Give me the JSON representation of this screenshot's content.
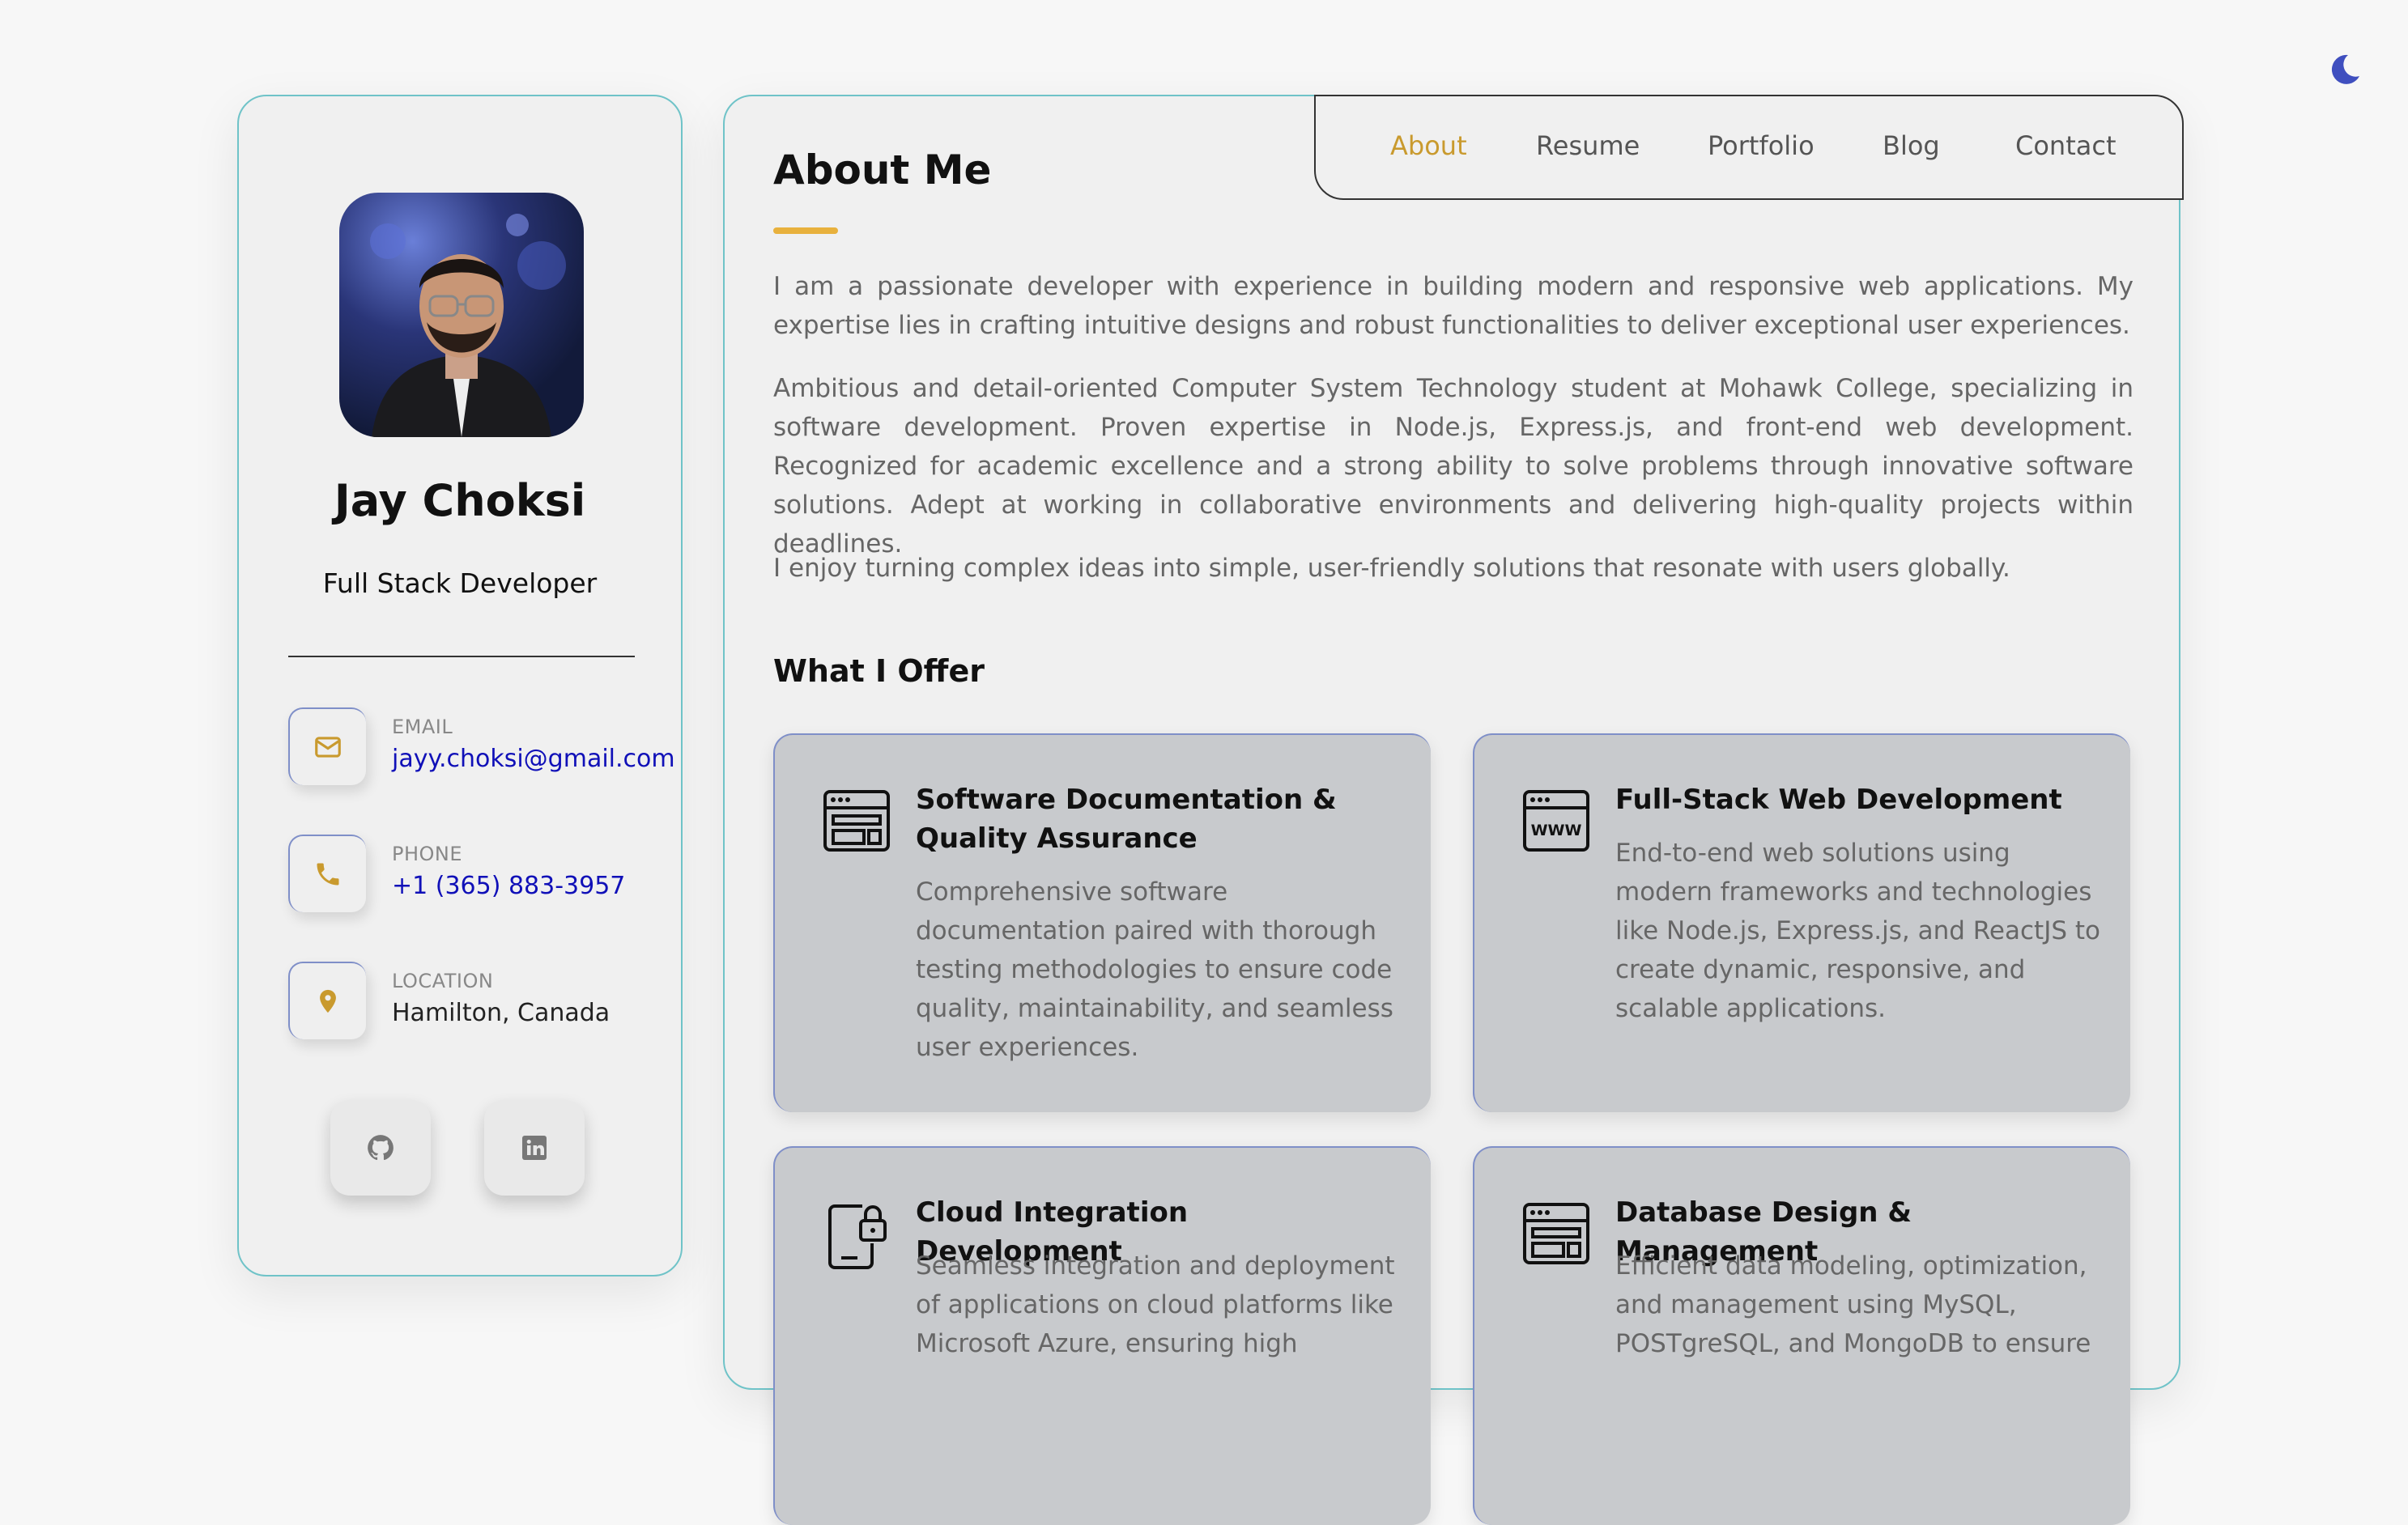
{
  "sidebar": {
    "name": "Jay Choksi",
    "role": "Full Stack Developer",
    "contacts": [
      {
        "label": "EMAIL",
        "value": "jayy.choksi@gmail.com",
        "icon": "mail-icon"
      },
      {
        "label": "PHONE",
        "value": "+1 (365) 883-3957",
        "icon": "phone-icon"
      },
      {
        "label": "LOCATION",
        "value": "Hamilton, Canada",
        "icon": "location-pin-icon"
      }
    ],
    "socials": [
      {
        "icon": "github-icon"
      },
      {
        "icon": "linkedin-icon"
      }
    ]
  },
  "nav": {
    "items": [
      "About",
      "Resume",
      "Portfolio",
      "Blog",
      "Contact"
    ],
    "active": "About"
  },
  "about": {
    "title": "About Me",
    "paragraphs": [
      "I am a passionate developer with experience in building modern and responsive web applications. My expertise lies in crafting intuitive designs and robust functionalities to deliver exceptional user experiences.",
      "Ambitious and detail-oriented Computer System Technology student at Mohawk College, specializing in software development. Proven expertise in Node.js, Express.js, and front-end web development. Recognized for academic excellence and a strong ability to solve problems through innovative software solutions. Adept at working in collaborative environments and delivering high-quality projects within deadlines.",
      "I enjoy turning complex ideas into simple, user-friendly solutions that resonate with users globally."
    ]
  },
  "offer": {
    "title": "What I Offer",
    "cards": [
      {
        "icon": "browser-layout-icon",
        "title": "Software Documentation & Quality Assurance",
        "desc": "Comprehensive software documentation paired with thorough testing methodologies to ensure code quality, maintainability, and seamless user experiences."
      },
      {
        "icon": "browser-www-icon",
        "title": "Full-Stack Web Development",
        "desc": "End-to-end web solutions using modern frameworks and technologies like Node.js, Express.js, and ReactJS to create dynamic, responsive, and scalable applications."
      },
      {
        "icon": "cloud-lock-icon",
        "title": "Cloud Integration Development",
        "desc": "Seamless integration and deployment of applications on cloud platforms like Microsoft Azure, ensuring high"
      },
      {
        "icon": "database-layout-icon",
        "title": "Database Design & Management",
        "desc": "Efficient data modeling, optimization, and management using MySQL, POSTgreSQL, and MongoDB to ensure"
      }
    ]
  },
  "colors": {
    "accent": "#c99a2e",
    "link": "#1010b8",
    "border": "#6fc3c8",
    "card": "#c8cacd"
  }
}
